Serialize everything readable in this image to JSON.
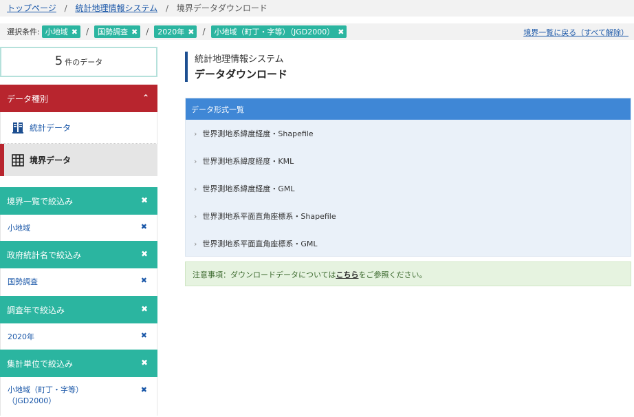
{
  "breadcrumb": {
    "items": [
      "トップページ",
      "統計地理情報システム"
    ],
    "current": "境界データダウンロード",
    "separator": "/"
  },
  "conditions": {
    "label": "選択条件:",
    "chips": [
      "小地域",
      "国勢調査",
      "2020年",
      "小地域（町丁・字等）（JGD2000）"
    ],
    "close_glyph": "✖",
    "back_link": "境界一覧に戻る（すべて解除）"
  },
  "result": {
    "count": "5",
    "unit": "件のデータ"
  },
  "data_type": {
    "header": "データ種別",
    "chevron": "⌃",
    "items": [
      {
        "label": "統計データ",
        "icon": "book-icon"
      },
      {
        "label": "境界データ",
        "icon": "grid-icon"
      }
    ]
  },
  "filters": [
    {
      "header": "境界一覧で絞込み",
      "value": "小地域"
    },
    {
      "header": "政府統計名で絞込み",
      "value": "国勢調査"
    },
    {
      "header": "調査年で絞込み",
      "value": "2020年"
    },
    {
      "header": "集計単位で絞込み",
      "value": "小地域（町丁・字等）",
      "value2": "（JGD2000）"
    }
  ],
  "title": {
    "sub": "統計地理情報システム",
    "main": "データダウンロード"
  },
  "formats": {
    "header": "データ形式一覧",
    "arrow": "›",
    "items": [
      "世界測地系緯度経度・Shapefile",
      "世界測地系緯度経度・KML",
      "世界測地系緯度経度・GML",
      "世界測地系平面直角座標系・Shapefile",
      "世界測地系平面直角座標系・GML"
    ]
  },
  "notice": {
    "prefix": "注意事項：ダウンロードデータについては",
    "link": "こちら",
    "suffix": "をご参照ください。"
  },
  "colors": {
    "teal": "#2bb5a0",
    "red": "#b8252e",
    "blue": "#3f87d6",
    "link": "#1a57a8"
  }
}
